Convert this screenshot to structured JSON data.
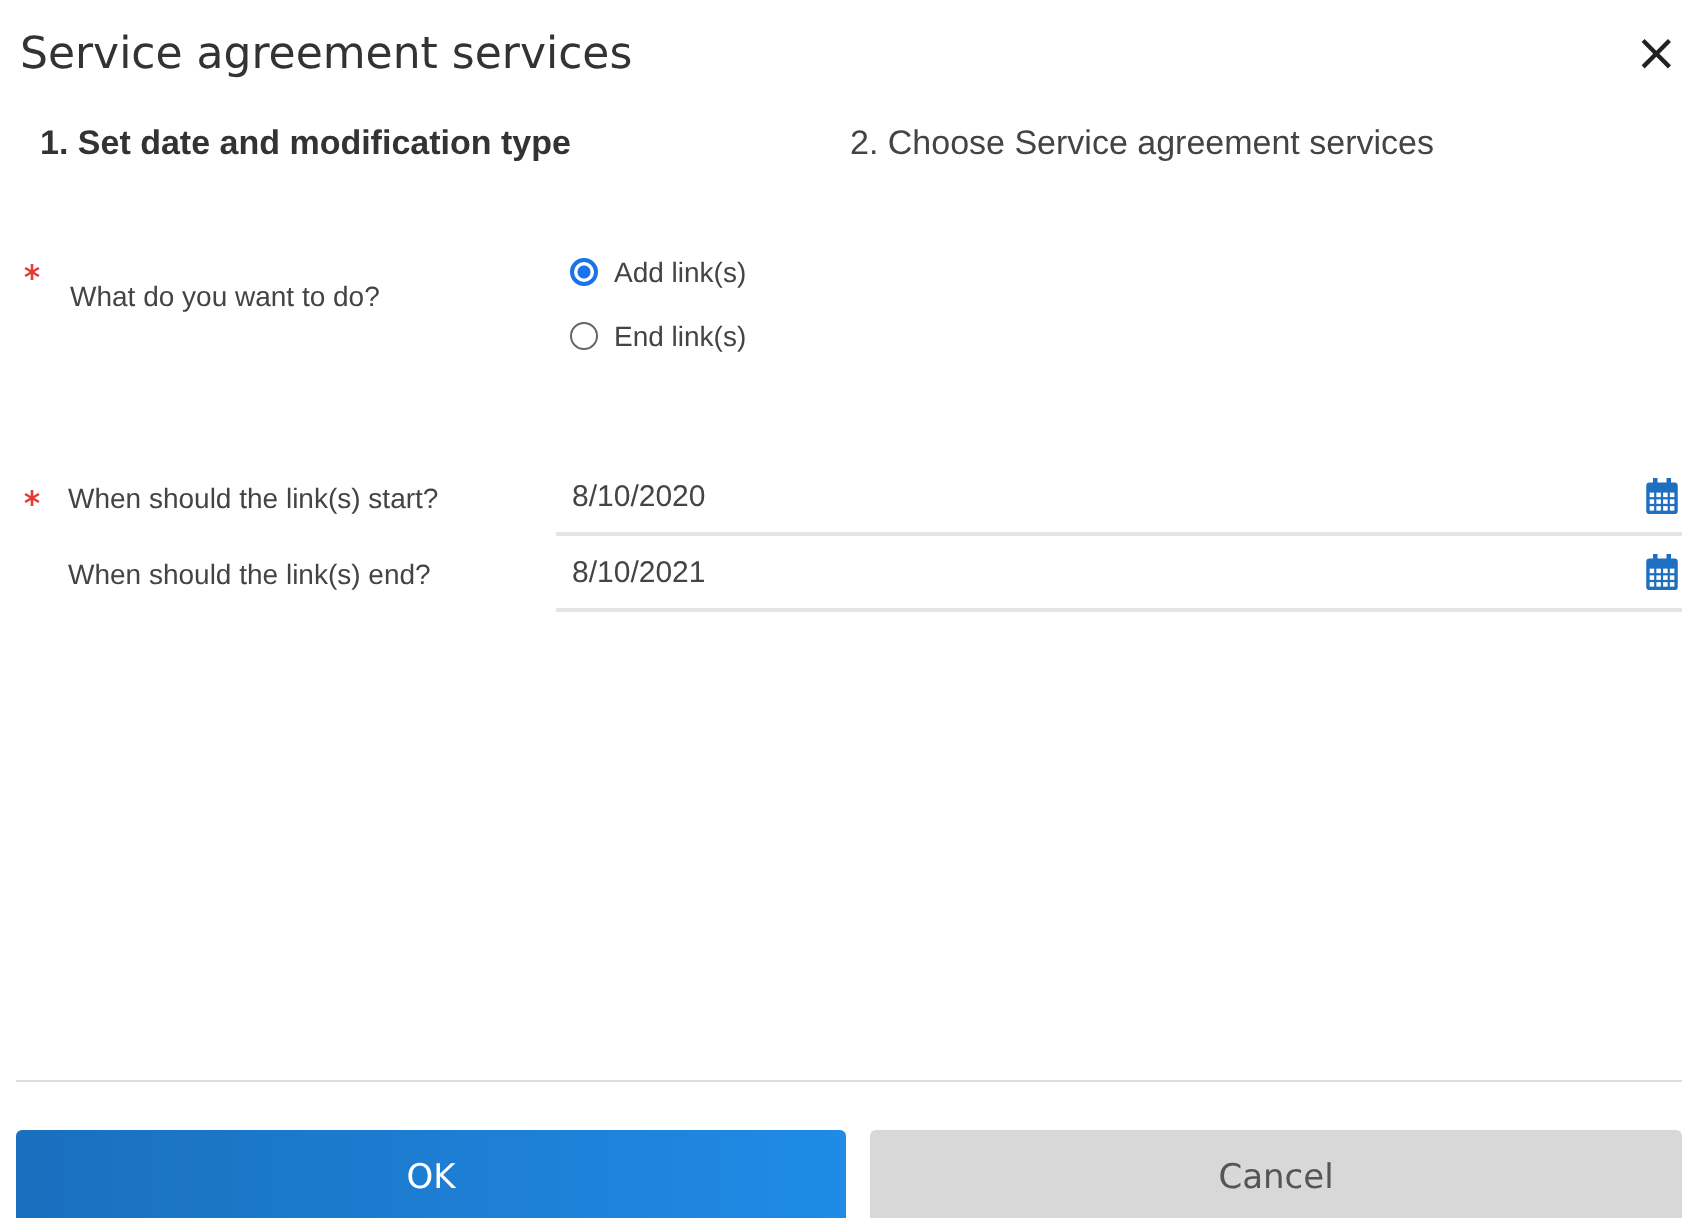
{
  "dialog": {
    "title": "Service agreement services",
    "close": "×"
  },
  "steps": [
    {
      "label": "1. Set date and modification type",
      "selected": true
    },
    {
      "label": "2. Choose Service agreement services",
      "selected": false
    }
  ],
  "question": {
    "label": "What do you want to do?",
    "required": true,
    "options": [
      {
        "label": "Add link(s)",
        "selected": true
      },
      {
        "label": "End link(s)",
        "selected": false
      }
    ]
  },
  "date_fields": [
    {
      "label": "When should the link(s) start?",
      "required": true,
      "value": "8/10/2020"
    },
    {
      "label": "When should the link(s) end?",
      "required": false,
      "value": "8/10/2021"
    }
  ],
  "buttons": [
    {
      "label": "OK",
      "kind": "primary"
    },
    {
      "label": "Cancel",
      "kind": "secondary"
    }
  ]
}
